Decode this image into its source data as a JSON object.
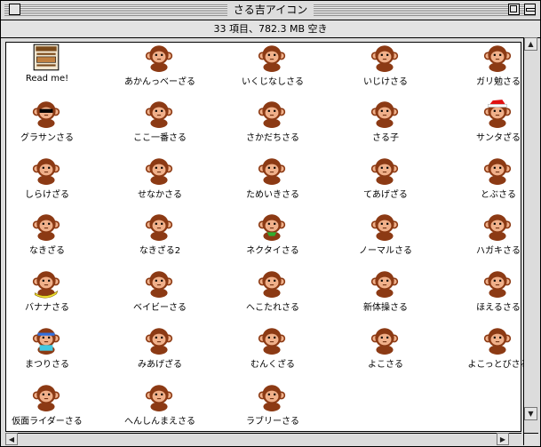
{
  "window": {
    "title": "さる吉アイコン",
    "info": "33 項目、782.3 MB 空き"
  },
  "colors": {
    "monkey_brown": "#8c3a14",
    "face_tan": "#f0b08a",
    "window_bg": "#dddddd"
  },
  "icons": [
    {
      "label": "Read me!",
      "icon": "document-icon"
    },
    {
      "label": "あかんっべーざる",
      "icon": "monkey-icon"
    },
    {
      "label": "いくじなしさる",
      "icon": "monkey-icon"
    },
    {
      "label": "いじけさる",
      "icon": "monkey-icon"
    },
    {
      "label": "ガリ勉さる",
      "icon": "monkey-icon"
    },
    {
      "label": "グラサンさる",
      "icon": "monkey-sunglasses-icon"
    },
    {
      "label": "ここ一番さる",
      "icon": "monkey-icon"
    },
    {
      "label": "さかだちさる",
      "icon": "monkey-icon"
    },
    {
      "label": "さる子",
      "icon": "monkey-icon"
    },
    {
      "label": "サンタざる",
      "icon": "monkey-santa-icon"
    },
    {
      "label": "しらけざる",
      "icon": "monkey-icon"
    },
    {
      "label": "せなかさる",
      "icon": "monkey-icon"
    },
    {
      "label": "ためいきさる",
      "icon": "monkey-icon"
    },
    {
      "label": "てあげざる",
      "icon": "monkey-icon"
    },
    {
      "label": "とぶさる",
      "icon": "monkey-icon"
    },
    {
      "label": "なきざる",
      "icon": "monkey-icon"
    },
    {
      "label": "なきざる2",
      "icon": "monkey-icon"
    },
    {
      "label": "ネクタイさる",
      "icon": "monkey-necktie-icon"
    },
    {
      "label": "ノーマルさる",
      "icon": "monkey-icon"
    },
    {
      "label": "ハガキさる",
      "icon": "monkey-icon"
    },
    {
      "label": "バナナさる",
      "icon": "monkey-banana-icon"
    },
    {
      "label": "ベイビーさる",
      "icon": "monkey-icon"
    },
    {
      "label": "へこたれさる",
      "icon": "monkey-icon"
    },
    {
      "label": "新体操さる",
      "icon": "monkey-icon"
    },
    {
      "label": "ほえるさる",
      "icon": "monkey-icon"
    },
    {
      "label": "まつりさる",
      "icon": "monkey-festival-icon"
    },
    {
      "label": "みあげざる",
      "icon": "monkey-icon"
    },
    {
      "label": "むんくざる",
      "icon": "monkey-icon"
    },
    {
      "label": "よこさる",
      "icon": "monkey-icon"
    },
    {
      "label": "よこっとびさる",
      "icon": "monkey-icon"
    },
    {
      "label": "仮面ライダーさる",
      "icon": "monkey-icon"
    },
    {
      "label": "へんしんまえさる",
      "icon": "monkey-icon"
    },
    {
      "label": "ラブリーさる",
      "icon": "monkey-icon"
    }
  ]
}
